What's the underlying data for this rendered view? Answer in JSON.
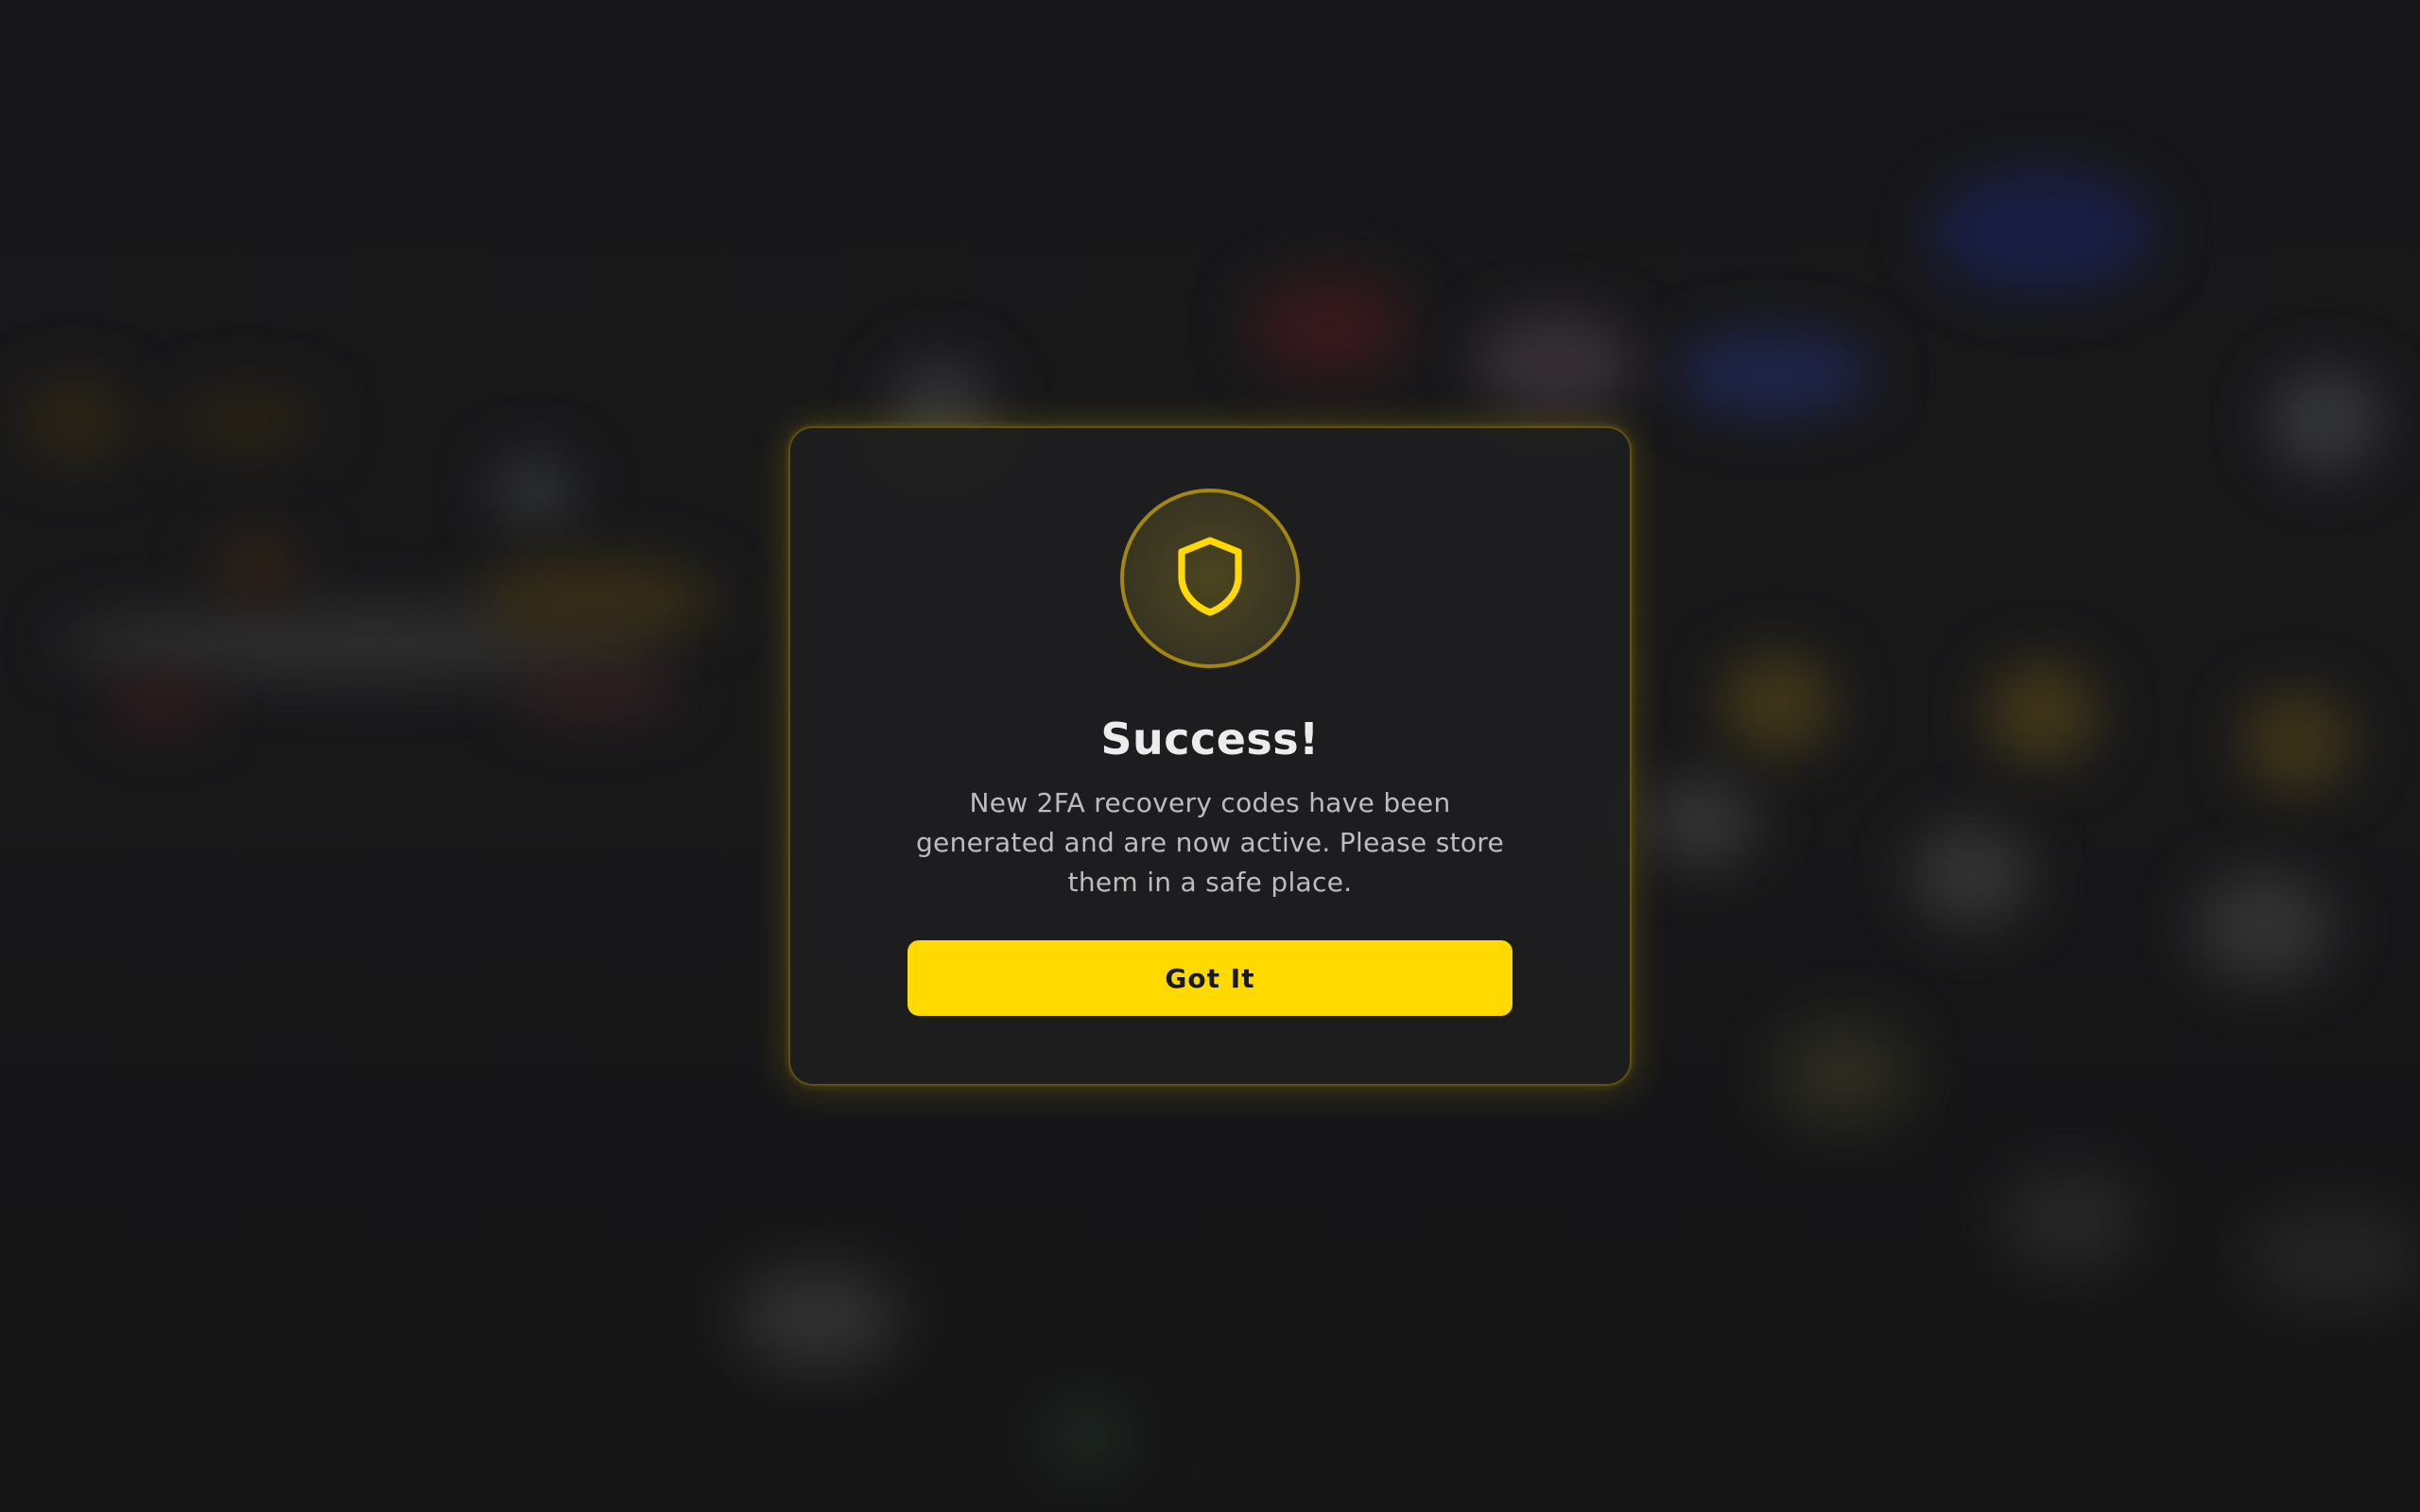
{
  "dialog": {
    "icon": "shield-icon",
    "title": "Success!",
    "message": "New 2FA recovery codes have been generated and are now active. Please store them in a safe place.",
    "button_label": "Got It"
  },
  "colors": {
    "accent": "#ffd900",
    "background": "#1a1a1b",
    "modal_border": "#5e5113",
    "title_text": "#ececec",
    "body_text": "#bdbdbd"
  }
}
